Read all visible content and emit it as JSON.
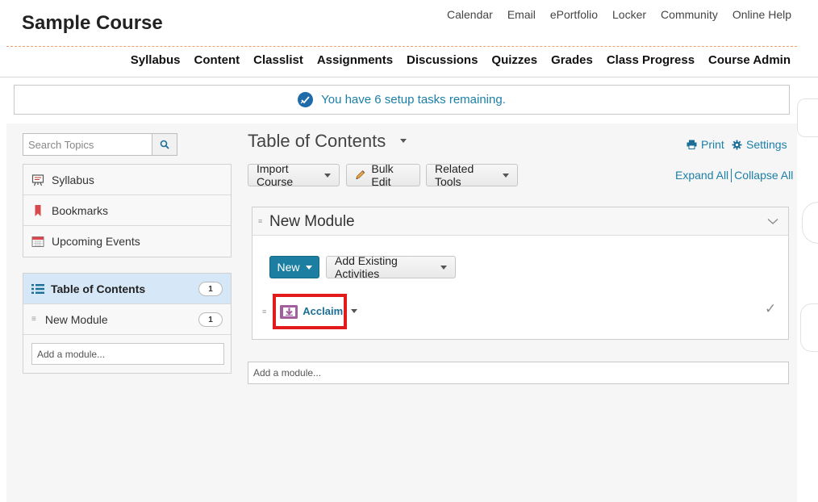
{
  "header": {
    "course_title": "Sample Course",
    "top_links": [
      "Calendar",
      "Email",
      "ePortfolio",
      "Locker",
      "Community",
      "Online Help"
    ],
    "main_nav": [
      "Syllabus",
      "Content",
      "Classlist",
      "Assignments",
      "Discussions",
      "Quizzes",
      "Grades",
      "Class Progress",
      "Course Admin"
    ]
  },
  "setup_banner": {
    "text": "You have 6 setup tasks remaining."
  },
  "left_panel": {
    "search_placeholder": "Search Topics",
    "tools": [
      {
        "label": "Syllabus",
        "icon": "syllabus-board-icon"
      },
      {
        "label": "Bookmarks",
        "icon": "bookmark-icon"
      },
      {
        "label": "Upcoming Events",
        "icon": "calendar-icon"
      }
    ],
    "toc": {
      "label": "Table of Contents",
      "count": "1",
      "modules": [
        {
          "label": "New Module",
          "count": "1"
        }
      ],
      "add_module_placeholder": "Add a module..."
    }
  },
  "main": {
    "title": "Table of Contents",
    "print_label": "Print",
    "settings_label": "Settings",
    "import_course_label": "Import Course",
    "bulk_edit_label": "Bulk Edit",
    "related_tools_label": "Related Tools",
    "expand_all_label": "Expand All",
    "collapse_all_label": "Collapse All",
    "module": {
      "title": "New Module",
      "new_button_label": "New",
      "add_existing_label": "Add Existing Activities",
      "activity": {
        "name": "Acclaim",
        "icon": "lti-link-icon"
      }
    },
    "add_module_placeholder": "Add a module..."
  },
  "colors": {
    "accent": "#1c7ea0",
    "link": "#1b7fa8",
    "highlight": "#e11b1b",
    "active_row": "#d6e8f7"
  }
}
